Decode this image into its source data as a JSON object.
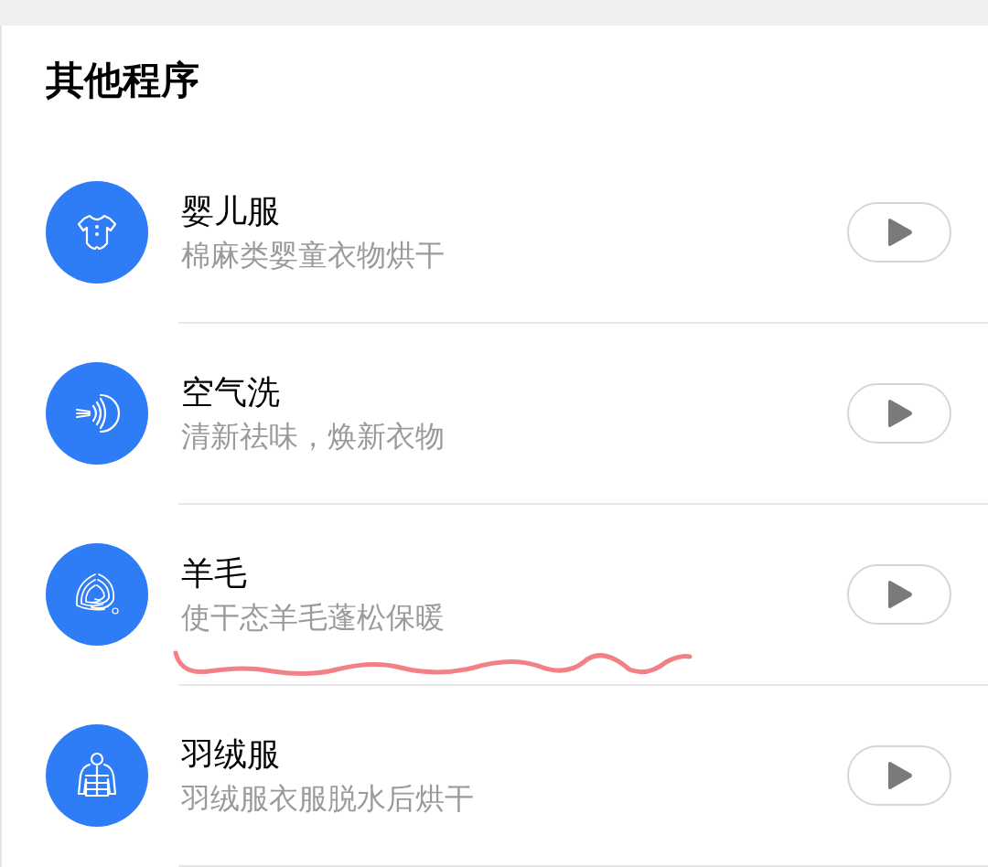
{
  "section": {
    "title": "其他程序"
  },
  "programs": [
    {
      "kind": "baby",
      "name": "婴儿服",
      "description": "棉麻类婴童衣物烘干"
    },
    {
      "kind": "air",
      "name": "空气洗",
      "description": "清新祛味，焕新衣物"
    },
    {
      "kind": "wool",
      "name": "羊毛",
      "description": "使干态羊毛蓬松保暖"
    },
    {
      "kind": "down",
      "name": "羽绒服",
      "description": "羽绒服衣服脱水后烘干"
    }
  ]
}
